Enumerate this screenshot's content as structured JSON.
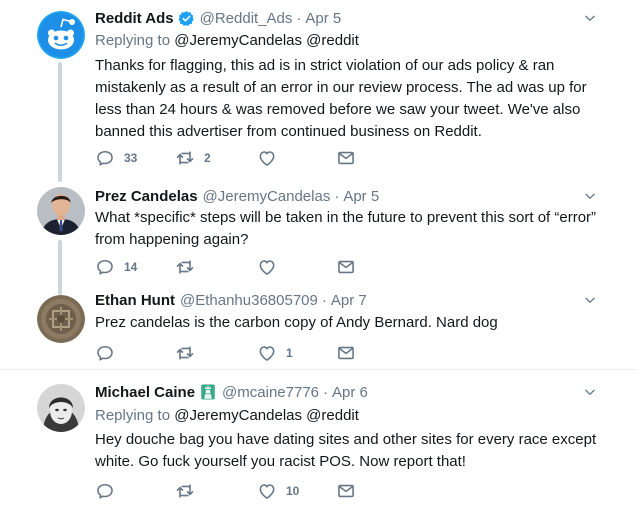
{
  "tweets": [
    {
      "name": "Reddit Ads",
      "verified": true,
      "handle": "@Reddit_Ads",
      "sep": "·",
      "date": "Apr 5",
      "replying_prefix": "Replying to",
      "replying_to": "@JeremyCandelas @reddit",
      "text": "Thanks for flagging, this ad is in strict violation of our ads policy & ran mistakenly as a result of an error in our review process. The ad was up for less than 24 hours & was removed before we saw your tweet. We've also banned this advertiser from continued business on Reddit.",
      "replies": "33",
      "retweets": "2",
      "likes": ""
    },
    {
      "name": "Prez Candelas",
      "handle": "@JeremyCandelas",
      "sep": "·",
      "date": "Apr 5",
      "text": "What *specific* steps will be taken in the future to prevent this sort of “error” from happening again?",
      "replies": "14",
      "retweets": "",
      "likes": ""
    },
    {
      "name": "Ethan Hunt",
      "handle": "@Ethanhu36805709",
      "sep": "·",
      "date": "Apr 7",
      "text": "Prez candelas is the carbon copy of Andy Bernard. Nard dog",
      "replies": "",
      "retweets": "",
      "likes": "1"
    },
    {
      "name": "Michael Caine",
      "handle": "@mcaine7776",
      "sep": "·",
      "date": "Apr 6",
      "replying_prefix": "Replying to",
      "replying_to": "@JeremyCandelas @reddit",
      "text": "Hey douche bag you have dating sites and other sites for every race except white. Go fuck yourself you racist POS. Now report that!",
      "replies": "",
      "retweets": "",
      "likes": "10"
    }
  ],
  "icons": {
    "reply": "reply-icon",
    "retweet": "retweet-icon",
    "like": "heart-icon",
    "dm": "envelope-icon",
    "caret": "chevron-down-icon",
    "verified": "verified-badge-icon"
  },
  "colors": {
    "text": "#14171a",
    "secondary": "#657786",
    "verified": "#1da1f2",
    "reddit_orange": "#ff4500",
    "thread_line": "#ccd6dd",
    "divider": "#e6ecf0"
  }
}
